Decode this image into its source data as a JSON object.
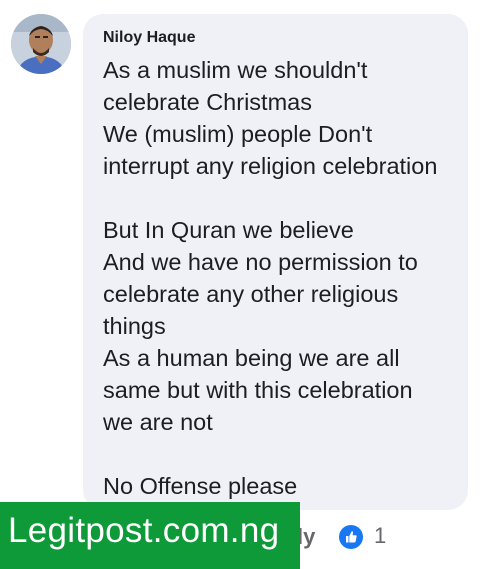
{
  "comment": {
    "author": "Niloy Haque",
    "lines": [
      "As a muslim we shouldn't",
      "celebrate Christmas",
      "We (muslim) people Don't",
      "interrupt any religion celebration",
      "",
      "But In Quran we believe",
      "And we have no permission to",
      "celebrate any other religious",
      "things",
      "As a human being we are all",
      "same but with this celebration",
      "we are not",
      "",
      "No Offense please"
    ]
  },
  "actions": {
    "reply_partial": "ly",
    "like_icon": "thumbs-up-icon",
    "reaction_count": "1"
  },
  "watermark": {
    "text": "Legitpost.com.ng"
  },
  "colors": {
    "bubble": "#eff1f6",
    "text": "#1c1e21",
    "muted": "#65676b",
    "like_blue": "#1877f2",
    "watermark_green": "#0f9a3a"
  }
}
